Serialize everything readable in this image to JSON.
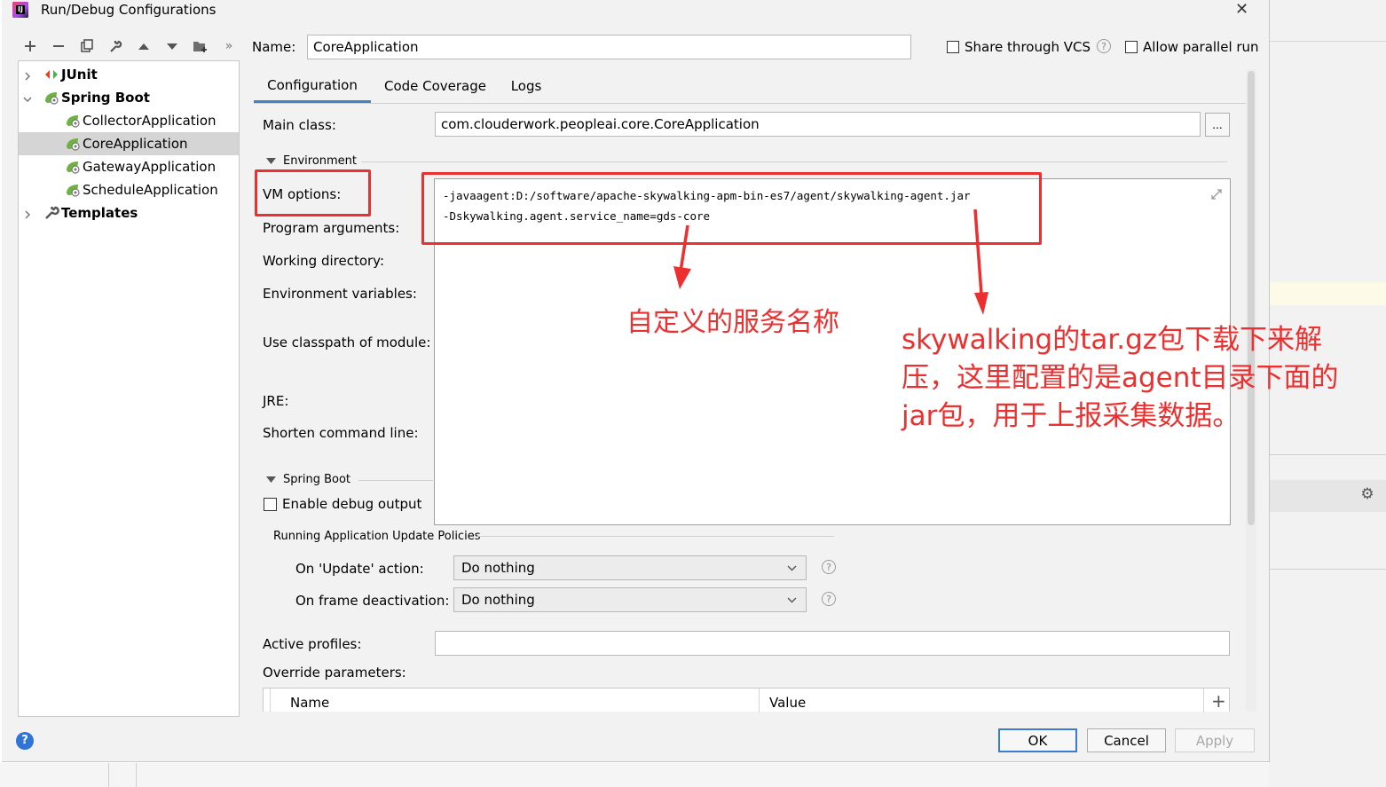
{
  "window": {
    "title": "Run/Debug Configurations",
    "close_glyph": "✕"
  },
  "toolbar": {
    "more_glyph": "»"
  },
  "tree": [
    {
      "label": "JUnit",
      "bold": true,
      "expanded": false
    },
    {
      "label": "Spring Boot",
      "bold": true,
      "expanded": true
    },
    {
      "label": "CollectorApplication"
    },
    {
      "label": "CoreApplication",
      "selected": true
    },
    {
      "label": "GatewayApplication"
    },
    {
      "label": "ScheduleApplication"
    },
    {
      "label": "Templates",
      "bold": true,
      "expanded": false
    }
  ],
  "header": {
    "name_label": "Name:",
    "name_value": "CoreApplication",
    "share_label": "Share through VCS",
    "share_checked": false,
    "parallel_label": "Allow parallel run",
    "parallel_checked": false
  },
  "tabs": [
    {
      "label": "Configuration",
      "active": true
    },
    {
      "label": "Code Coverage"
    },
    {
      "label": "Logs"
    }
  ],
  "form": {
    "main_class_label": "Main class:",
    "main_class_value": "com.clouderwork.peopleai.core.CoreApplication",
    "browse_label": "...",
    "environment_header": "Environment",
    "vm_options_label": "VM options:",
    "vm_options_lines": [
      "-javaagent:D:/software/apache-skywalking-apm-bin-es7/agent/skywalking-agent.jar",
      "-Dskywalking.agent.service_name=gds-core"
    ],
    "program_args_label": "Program arguments:",
    "working_dir_label": "Working directory:",
    "env_vars_label": "Environment variables:",
    "classpath_label": "Use classpath of module:",
    "jre_label": "JRE:",
    "shorten_label": "Shorten command line:",
    "spring_boot_header": "Spring Boot",
    "debug_output_label": "Enable debug output",
    "debug_output_checked": false,
    "policies_header": "Running Application Update Policies",
    "update_action_label": "On 'Update' action:",
    "update_action_value": "Do nothing",
    "frame_deactivation_label": "On frame deactivation:",
    "frame_deactivation_value": "Do nothing",
    "active_profiles_label": "Active profiles:",
    "active_profiles_value": "",
    "override_params_label": "Override parameters:",
    "override_columns": [
      "Name",
      "Value"
    ],
    "add_glyph": "+"
  },
  "footer": {
    "help_glyph": "?",
    "ok_label": "OK",
    "cancel_label": "Cancel",
    "apply_label": "Apply"
  },
  "annotations": {
    "service_name_note": "自定义的服务名称",
    "agent_note": [
      "skywalking的tar.gz包下载下来解",
      "压，这里配置的是agent目录下面的",
      "jar包，用于上报采集数据。"
    ],
    "color": "#ec2f2f"
  }
}
